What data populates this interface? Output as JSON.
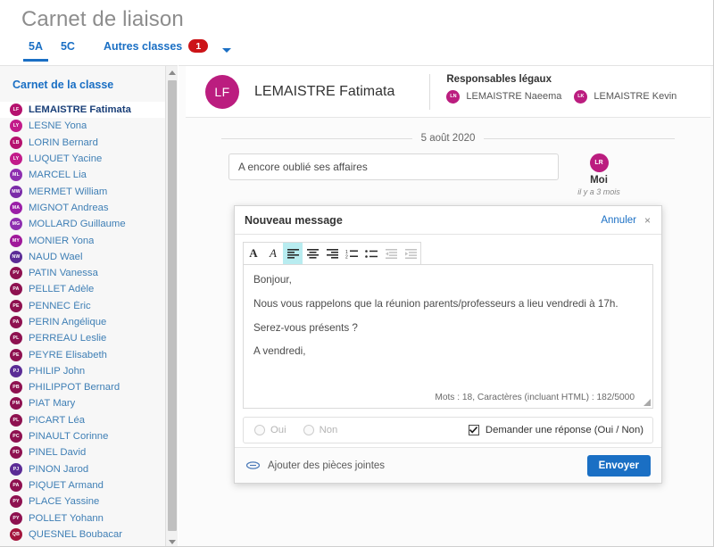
{
  "header": {
    "title": "Carnet de liaison",
    "tabs": [
      {
        "label": "5A",
        "active": true
      },
      {
        "label": "5C",
        "active": false
      }
    ],
    "other_classes": {
      "label": "Autres classes",
      "count": "1"
    }
  },
  "sidebar": {
    "title": "Carnet de la classe",
    "students": [
      {
        "initials": "LF",
        "name": "LEMAISTRE Fatimata",
        "color": "#b5126e",
        "selected": true
      },
      {
        "initials": "LY",
        "name": "LESNE Yona",
        "color": "#c21b8a"
      },
      {
        "initials": "LB",
        "name": "LORIN Bernard",
        "color": "#b5126e"
      },
      {
        "initials": "LY",
        "name": "LUQUET Yacine",
        "color": "#c21b8a"
      },
      {
        "initials": "ML",
        "name": "MARCEL Lia",
        "color": "#8e2fb0"
      },
      {
        "initials": "MW",
        "name": "MERMET William",
        "color": "#7a2ba8"
      },
      {
        "initials": "MA",
        "name": "MIGNOT Andreas",
        "color": "#9b1fa8"
      },
      {
        "initials": "MG",
        "name": "MOLLARD Guillaume",
        "color": "#8e2fb0"
      },
      {
        "initials": "MY",
        "name": "MONIER Yona",
        "color": "#a0199a"
      },
      {
        "initials": "NW",
        "name": "NAUD Wael",
        "color": "#5b2c96"
      },
      {
        "initials": "PV",
        "name": "PATIN Vanessa",
        "color": "#8e1150"
      },
      {
        "initials": "PA",
        "name": "PELLET Adèle",
        "color": "#8e1150"
      },
      {
        "initials": "PE",
        "name": "PENNEC Éric",
        "color": "#8e1150"
      },
      {
        "initials": "PA",
        "name": "PERIN Angélique",
        "color": "#8e1150"
      },
      {
        "initials": "PL",
        "name": "PERREAU Leslie",
        "color": "#8e1150"
      },
      {
        "initials": "PE",
        "name": "PEYRE Elisabeth",
        "color": "#8e1150"
      },
      {
        "initials": "PJ",
        "name": "PHILIP John",
        "color": "#5b2c96"
      },
      {
        "initials": "PB",
        "name": "PHILIPPOT Bernard",
        "color": "#8e1150"
      },
      {
        "initials": "PM",
        "name": "PIAT Mary",
        "color": "#8e1150"
      },
      {
        "initials": "PL",
        "name": "PICART Léa",
        "color": "#8e1150"
      },
      {
        "initials": "PC",
        "name": "PINAULT Corinne",
        "color": "#8e1150"
      },
      {
        "initials": "PD",
        "name": "PINEL David",
        "color": "#8e1150"
      },
      {
        "initials": "PJ",
        "name": "PINON Jarod",
        "color": "#5b2c96"
      },
      {
        "initials": "PA",
        "name": "PIQUET Armand",
        "color": "#8e1150"
      },
      {
        "initials": "PY",
        "name": "PLACE Yassine",
        "color": "#8e1150"
      },
      {
        "initials": "PY",
        "name": "POLLET Yohann",
        "color": "#8e1150"
      },
      {
        "initials": "QB",
        "name": "QUESNEL Boubacar",
        "color": "#a3153c"
      }
    ]
  },
  "student": {
    "initials": "LF",
    "name": "LEMAISTRE Fatimata",
    "avatar_color": "#bb1d7f",
    "guardians_title": "Responsables légaux",
    "guardians": [
      {
        "initials": "LN",
        "name": "LEMAISTRE Naeema"
      },
      {
        "initials": "LK",
        "name": "LEMAISTRE Kevin"
      }
    ]
  },
  "thread": {
    "date": "5 août 2020",
    "message": {
      "text": "A encore oublié ses affaires",
      "author_initials": "LR",
      "author": "Moi",
      "time": "il y a 3 mois"
    }
  },
  "dialog": {
    "title": "Nouveau message",
    "cancel_label": "Annuler",
    "close_icon": "×",
    "toolbar": [
      {
        "name": "bold-icon",
        "glyph": "A",
        "state": "normal"
      },
      {
        "name": "italic-icon",
        "glyph": "A",
        "state": "normal"
      },
      {
        "name": "align-left-icon",
        "state": "active"
      },
      {
        "name": "align-center-icon",
        "state": "normal"
      },
      {
        "name": "align-right-icon",
        "state": "normal"
      },
      {
        "name": "ordered-list-icon",
        "state": "normal"
      },
      {
        "name": "unordered-list-icon",
        "state": "normal"
      },
      {
        "name": "outdent-icon",
        "state": "disabled"
      },
      {
        "name": "indent-icon",
        "state": "disabled"
      }
    ],
    "body": [
      "Bonjour,",
      "Nous vous rappelons que la réunion parents/professeurs a lieu vendredi à 17h.",
      "Serez-vous présents ?",
      "A vendredi,"
    ],
    "counter": "Mots : 18, Caractères (incluant HTML) : 182/5000",
    "answer": {
      "yes_label": "Oui",
      "no_label": "Non",
      "request_label": "Demander une réponse (Oui / Non)",
      "request_checked": true
    },
    "footer": {
      "attach_label": "Ajouter des pièces jointes",
      "send_label": "Envoyer"
    }
  },
  "colors": {
    "accent_blue": "#1a6fc4",
    "badge_red": "#cc1418",
    "magenta": "#bb1d7f",
    "toolbar_active": "#b8ecf0"
  }
}
